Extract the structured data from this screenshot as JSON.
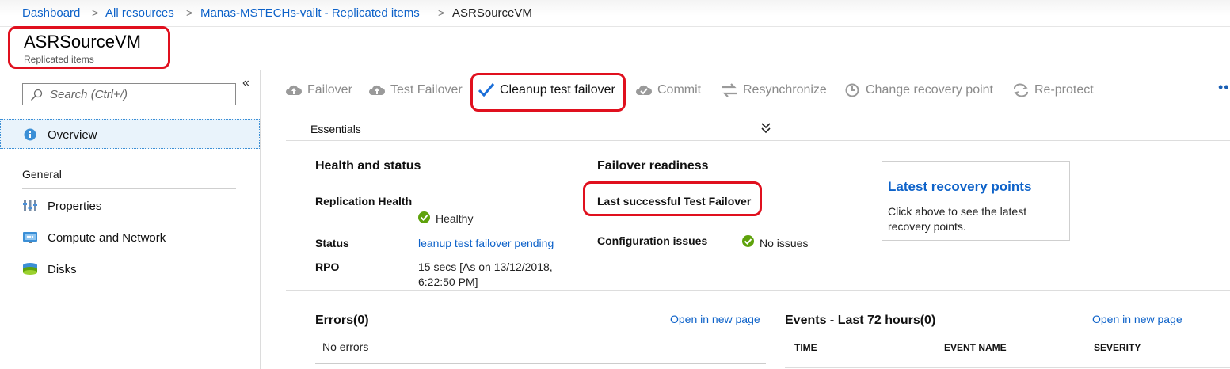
{
  "breadcrumb": {
    "items": [
      "Dashboard",
      "All resources",
      "Manas-MSTECHs-vailt - Replicated items"
    ],
    "separator": ">",
    "current": "ASRSourceVM"
  },
  "header": {
    "title": "ASRSourceVM",
    "subtitle": "Replicated items"
  },
  "sidebar": {
    "search_placeholder": "Search (Ctrl+/)",
    "collapse_glyph": "«",
    "overview_label": "Overview",
    "section_general": "General",
    "items": [
      {
        "label": "Properties",
        "icon": "properties-icon"
      },
      {
        "label": "Compute and Network",
        "icon": "network-icon"
      },
      {
        "label": "Disks",
        "icon": "disks-icon"
      }
    ]
  },
  "toolbar": {
    "items": [
      {
        "label": "Failover",
        "icon": "cloud-failover-icon",
        "enabled": false
      },
      {
        "label": "Test Failover",
        "icon": "cloud-test-failover-icon",
        "enabled": false
      },
      {
        "label": "Cleanup test failover",
        "icon": "checkmark-icon",
        "enabled": true
      },
      {
        "label": "Commit",
        "icon": "cloud-commit-icon",
        "enabled": false
      },
      {
        "label": "Resynchronize",
        "icon": "resync-icon",
        "enabled": false
      },
      {
        "label": "Change recovery point",
        "icon": "history-icon",
        "enabled": false
      },
      {
        "label": "Re-protect",
        "icon": "reprotect-icon",
        "enabled": false
      }
    ],
    "more": "•••"
  },
  "essentials": {
    "label": "Essentials",
    "chevron": "⌄"
  },
  "health": {
    "heading": "Health and status",
    "replication_health_label": "Replication Health",
    "replication_health_value": "Healthy",
    "status_label": "Status",
    "status_value": "leanup test failover pending",
    "rpo_label": "RPO",
    "rpo_value_line1": "15 secs [As on 13/12/2018,",
    "rpo_value_line2": "6:22:50 PM]"
  },
  "failover": {
    "heading": "Failover readiness",
    "last_test_label": "Last successful Test Failover",
    "config_label": "Configuration issues",
    "config_value": "No issues"
  },
  "recovery_points": {
    "title": "Latest recovery points",
    "description": "Click above to see the latest recovery points."
  },
  "errors": {
    "heading": "Errors(0)",
    "open_link": "Open in new page",
    "empty_text": "No errors"
  },
  "events": {
    "heading": "Events - Last 72 hours(0)",
    "open_link": "Open in new page",
    "columns": [
      "TIME",
      "EVENT NAME",
      "SEVERITY"
    ]
  },
  "colors": {
    "link": "#0d62c9",
    "highlight": "#e0101e",
    "healthy": "#5ea20b"
  }
}
